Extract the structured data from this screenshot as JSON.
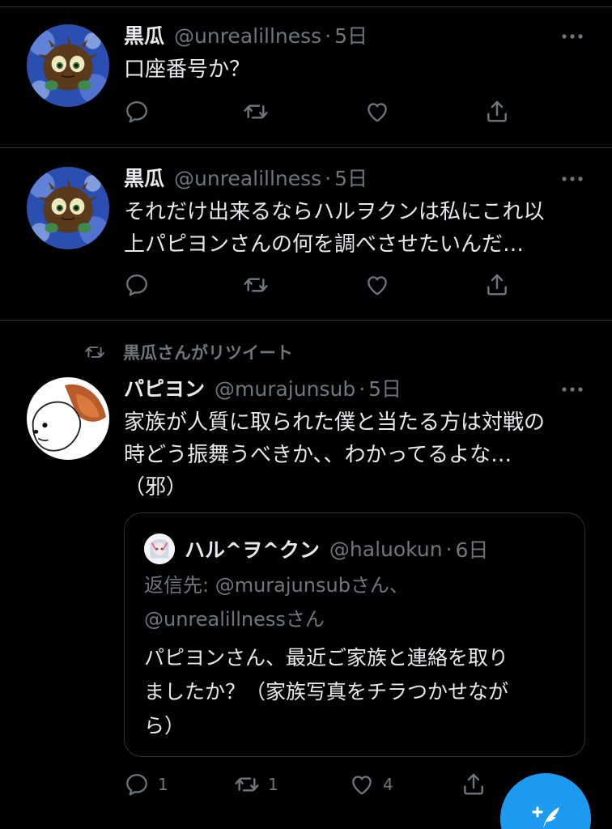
{
  "tweets": [
    {
      "name": "黒瓜",
      "handle": "@unrealillness",
      "dot": "·",
      "time": "5日",
      "text": "口座番号か？"
    },
    {
      "name": "黒瓜",
      "handle": "@unrealillness",
      "dot": "·",
      "time": "5日",
      "text_line1": "それだけ出来るならハルヲクンは私にこれ以",
      "text_line2": "上パピヨンさんの何を調べさせたいんだ…"
    },
    {
      "retweet_context": "黒瓜さんがリツイート",
      "name": "パピヨン",
      "handle": "@murajunsub",
      "dot": "·",
      "time": "5日",
      "text_line1": "家族が人質に取られた僕と当たる方は対戦の",
      "text_line2": "時どう振舞うべきか、、わかってるよな…",
      "text_line3": "（邪）",
      "quote": {
        "name": "ハル^ヲ^クン",
        "handle": "@haluokun",
        "dot": "·",
        "time": "6日",
        "reply_prefix": "返信先: ",
        "reply_mention1": "@murajunsub",
        "reply_suffix1": "さん、",
        "reply_mention2": "@unrealillness",
        "reply_suffix2": "さん",
        "text_line1": "パピヨンさん、最近ご家族と連絡を取り",
        "text_line2": "ましたか？（家族写真をチラつかせなが",
        "text_line3": "ら）"
      },
      "reply_count": "1",
      "retweet_count": "1",
      "like_count": "4"
    }
  ],
  "icons": [
    "reply-icon",
    "retweet-icon",
    "like-icon",
    "share-icon",
    "more-icon",
    "compose-icon"
  ],
  "colors": {
    "background": "#000000",
    "text": "#e7e9ea",
    "muted": "#71767b",
    "accent": "#1d9bf0",
    "border": "#2f3336"
  }
}
